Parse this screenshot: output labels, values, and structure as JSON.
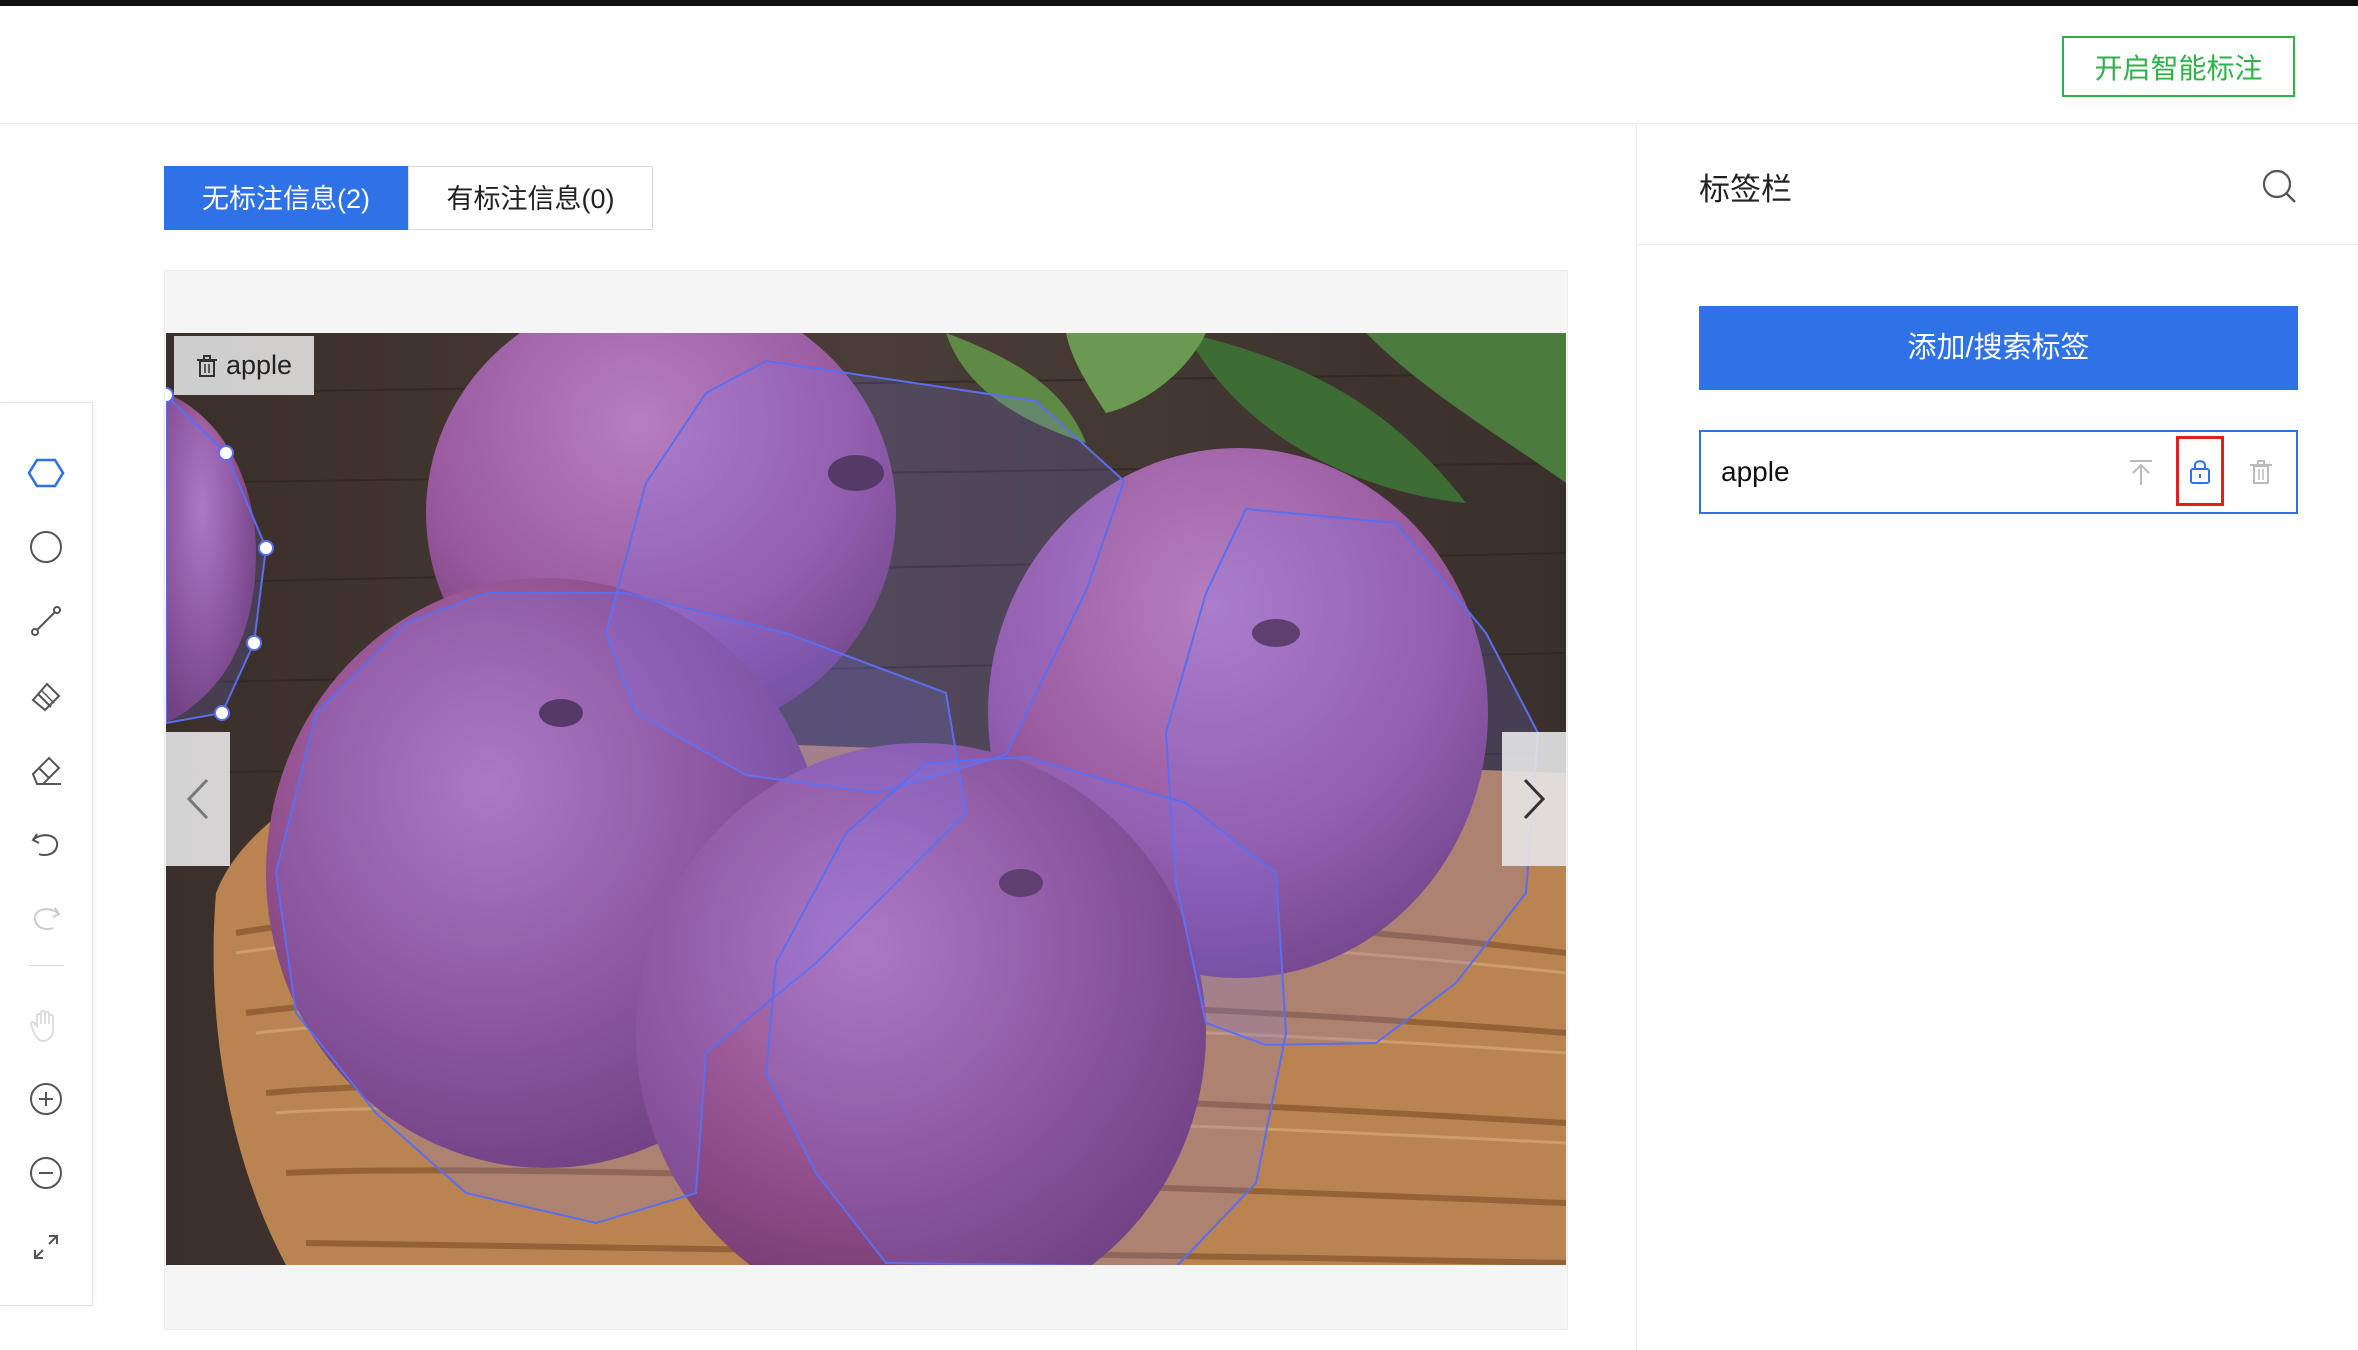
{
  "header": {
    "smart_label_button": "开启智能标注"
  },
  "tabs": [
    {
      "label": "无标注信息(2)",
      "active": true
    },
    {
      "label": "有标注信息(0)",
      "active": false
    }
  ],
  "toolbar": {
    "tools": [
      "polygon-icon",
      "circle-icon",
      "line-icon",
      "brush-icon",
      "eraser-icon",
      "undo-icon",
      "redo-icon",
      "hand-icon",
      "zoom-in-icon",
      "zoom-out-icon",
      "fullscreen-icon"
    ]
  },
  "canvas": {
    "label_tag": "apple"
  },
  "label_panel": {
    "title": "标签栏",
    "add_button": "添加/搜索标签",
    "tags": [
      {
        "name": "apple"
      }
    ]
  },
  "colors": {
    "accent": "#2f72e8",
    "smart_button": "#2db24a",
    "highlight": "#e02020"
  }
}
